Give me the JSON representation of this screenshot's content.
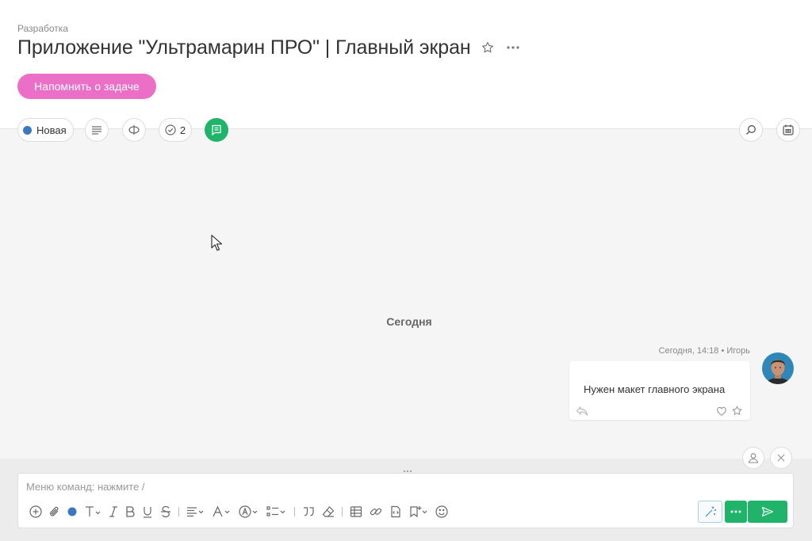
{
  "header": {
    "breadcrumb": "Разработка",
    "title": "Приложение \"Ультрамарин ПРО\" | Главный экран",
    "remind_label": "Напомнить о задаче"
  },
  "toolbar": {
    "status_label": "Новая",
    "status_color": "#3a78c2",
    "checklist_count": "2"
  },
  "chat": {
    "day_separator": "Сегодня",
    "messages": [
      {
        "meta": "Сегодня, 14:18 • Игорь",
        "text": "Нужен макет главного экрана"
      }
    ]
  },
  "composer": {
    "placeholder": "Меню команд: нажмите /"
  },
  "colors": {
    "accent_pink": "#ec6fc7",
    "accent_green": "#20b46b"
  }
}
